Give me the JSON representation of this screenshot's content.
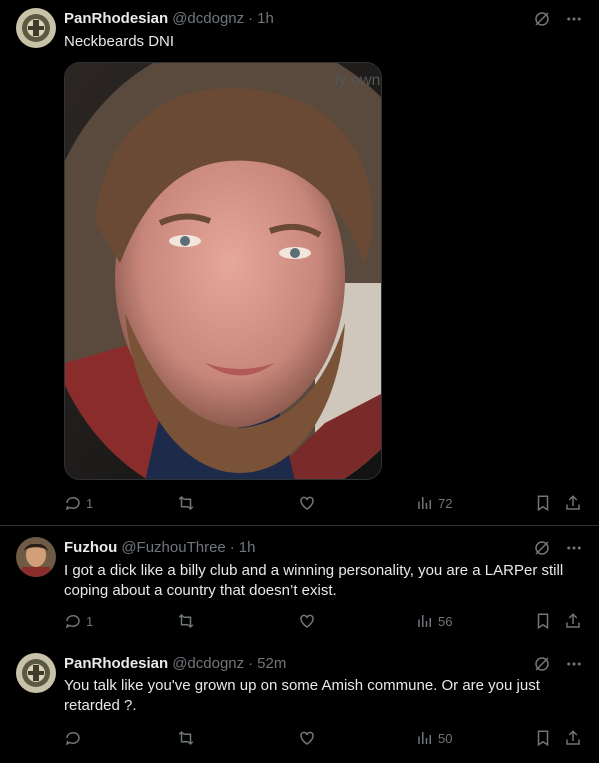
{
  "tweets": [
    {
      "name": "PanRhodesian",
      "handle": "@dcdognz",
      "time": "1h",
      "text": "Neckbeards DNI",
      "replies": "1",
      "retweets": "",
      "likes": "",
      "views": "72"
    },
    {
      "name": "Fuzhou",
      "handle": "@FuzhouThree",
      "time": "1h",
      "text": "I got a dick like a billy club and a winning personality, you are a LARPer still coping about a country that doesn’t exist.",
      "replies": "1",
      "retweets": "",
      "likes": "",
      "views": "56"
    },
    {
      "name": "PanRhodesian",
      "handle": "@dcdognz",
      "time": "52m",
      "text": "You talk like you've grown up on some Amish commune. Or are you just retarded ?.",
      "replies": "",
      "retweets": "",
      "likes": "",
      "views": "50"
    }
  ],
  "media_watermark": "ly own",
  "separator": "·",
  "colors": {
    "background": "#000000",
    "text": "#e7e9ea",
    "muted": "#71767b",
    "border": "#2f3336"
  },
  "icons": [
    "grok-icon",
    "more-icon",
    "reply-icon",
    "retweet-icon",
    "like-icon",
    "views-icon",
    "bookmark-icon",
    "share-icon"
  ]
}
